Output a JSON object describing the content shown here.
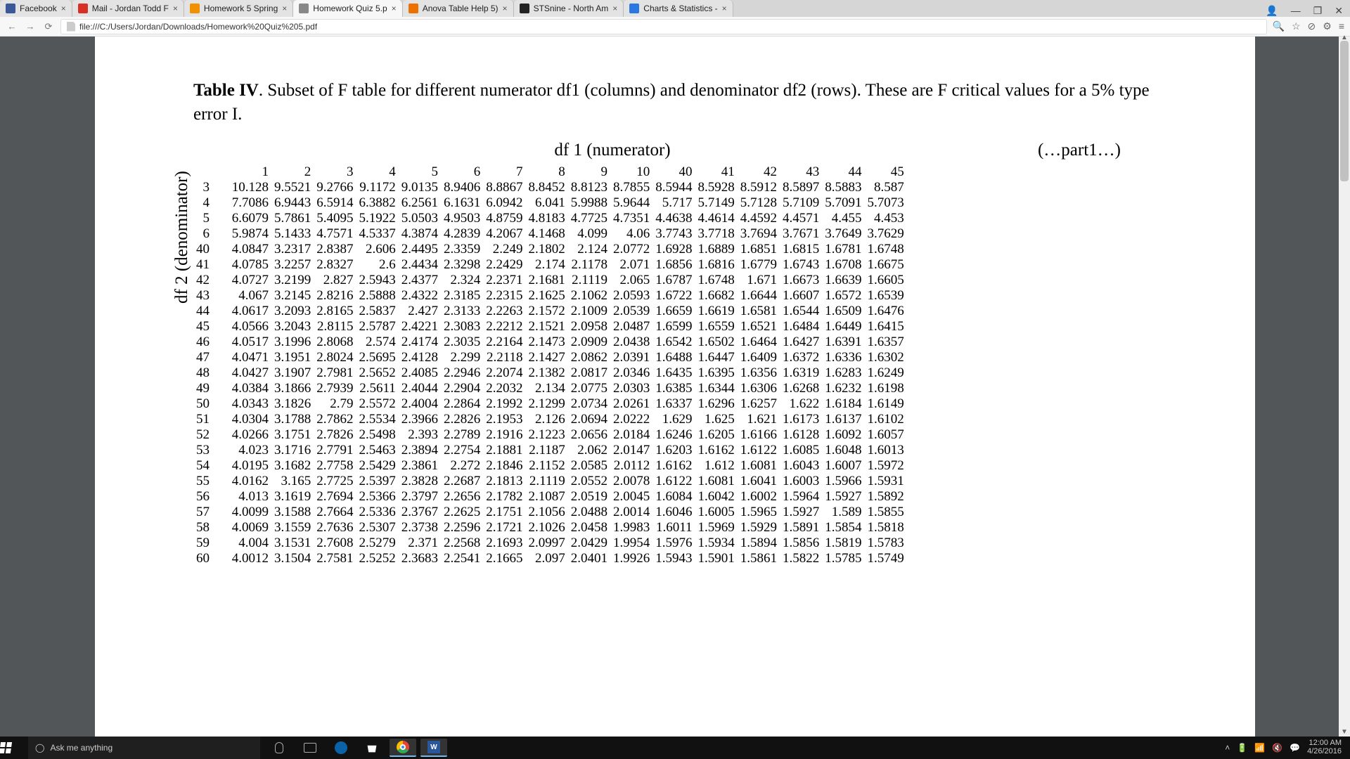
{
  "tabs": [
    {
      "title": "Facebook",
      "fav": "fav-fb"
    },
    {
      "title": "Mail - Jordan Todd F",
      "fav": "fav-gm"
    },
    {
      "title": "Homework 5 Spring",
      "fav": "fav-canvas"
    },
    {
      "title": "Homework Quiz 5.p",
      "fav": "fav-doc",
      "active": true
    },
    {
      "title": "Anova Table Help 5)",
      "fav": "fav-chegg"
    },
    {
      "title": "STSnine - North Am",
      "fav": "fav-st"
    },
    {
      "title": "Charts & Statistics -",
      "fav": "fav-chart"
    }
  ],
  "url": "file:///C:/Users/Jordan/Downloads/Homework%20Quiz%205.pdf",
  "doc": {
    "caption_strong": "Table IV",
    "caption_rest": ". Subset of F table for different numerator df1 (columns) and denominator df2 (rows). These are F critical values for a 5% type error I.",
    "header_center": "df 1 (numerator)",
    "header_right": "(…part1…)",
    "ylabel": "df 2 (denominator)"
  },
  "chart_data": {
    "type": "table",
    "title": "F critical values, α = 0.05",
    "col_label": "df1 (numerator)",
    "row_label": "df2 (denominator)",
    "columns": [
      1,
      2,
      3,
      4,
      5,
      6,
      7,
      8,
      9,
      10,
      40,
      41,
      42,
      43,
      44,
      45
    ],
    "rows": [
      3,
      4,
      5,
      6,
      40,
      41,
      42,
      43,
      44,
      45,
      46,
      47,
      48,
      49,
      50,
      51,
      52,
      53,
      54,
      55,
      56,
      57,
      58,
      59,
      60
    ],
    "values": [
      [
        10.128,
        9.5521,
        9.2766,
        9.1172,
        9.0135,
        8.9406,
        8.8867,
        8.8452,
        8.8123,
        8.7855,
        8.5944,
        8.5928,
        8.5912,
        8.5897,
        8.5883,
        8.587
      ],
      [
        7.7086,
        6.9443,
        6.5914,
        6.3882,
        6.2561,
        6.1631,
        6.0942,
        6.041,
        5.9988,
        5.9644,
        5.717,
        5.7149,
        5.7128,
        5.7109,
        5.7091,
        5.7073
      ],
      [
        6.6079,
        5.7861,
        5.4095,
        5.1922,
        5.0503,
        4.9503,
        4.8759,
        4.8183,
        4.7725,
        4.7351,
        4.4638,
        4.4614,
        4.4592,
        4.4571,
        4.455,
        4.453
      ],
      [
        5.9874,
        5.1433,
        4.7571,
        4.5337,
        4.3874,
        4.2839,
        4.2067,
        4.1468,
        4.099,
        4.06,
        3.7743,
        3.7718,
        3.7694,
        3.7671,
        3.7649,
        3.7629
      ],
      [
        4.0847,
        3.2317,
        2.8387,
        2.606,
        2.4495,
        2.3359,
        2.249,
        2.1802,
        2.124,
        2.0772,
        1.6928,
        1.6889,
        1.6851,
        1.6815,
        1.6781,
        1.6748
      ],
      [
        4.0785,
        3.2257,
        2.8327,
        2.6,
        2.4434,
        2.3298,
        2.2429,
        2.174,
        2.1178,
        2.071,
        1.6856,
        1.6816,
        1.6779,
        1.6743,
        1.6708,
        1.6675
      ],
      [
        4.0727,
        3.2199,
        2.827,
        2.5943,
        2.4377,
        2.324,
        2.2371,
        2.1681,
        2.1119,
        2.065,
        1.6787,
        1.6748,
        1.671,
        1.6673,
        1.6639,
        1.6605
      ],
      [
        4.067,
        3.2145,
        2.8216,
        2.5888,
        2.4322,
        2.3185,
        2.2315,
        2.1625,
        2.1062,
        2.0593,
        1.6722,
        1.6682,
        1.6644,
        1.6607,
        1.6572,
        1.6539
      ],
      [
        4.0617,
        3.2093,
        2.8165,
        2.5837,
        2.427,
        2.3133,
        2.2263,
        2.1572,
        2.1009,
        2.0539,
        1.6659,
        1.6619,
        1.6581,
        1.6544,
        1.6509,
        1.6476
      ],
      [
        4.0566,
        3.2043,
        2.8115,
        2.5787,
        2.4221,
        2.3083,
        2.2212,
        2.1521,
        2.0958,
        2.0487,
        1.6599,
        1.6559,
        1.6521,
        1.6484,
        1.6449,
        1.6415
      ],
      [
        4.0517,
        3.1996,
        2.8068,
        2.574,
        2.4174,
        2.3035,
        2.2164,
        2.1473,
        2.0909,
        2.0438,
        1.6542,
        1.6502,
        1.6464,
        1.6427,
        1.6391,
        1.6357
      ],
      [
        4.0471,
        3.1951,
        2.8024,
        2.5695,
        2.4128,
        2.299,
        2.2118,
        2.1427,
        2.0862,
        2.0391,
        1.6488,
        1.6447,
        1.6409,
        1.6372,
        1.6336,
        1.6302
      ],
      [
        4.0427,
        3.1907,
        2.7981,
        2.5652,
        2.4085,
        2.2946,
        2.2074,
        2.1382,
        2.0817,
        2.0346,
        1.6435,
        1.6395,
        1.6356,
        1.6319,
        1.6283,
        1.6249
      ],
      [
        4.0384,
        3.1866,
        2.7939,
        2.5611,
        2.4044,
        2.2904,
        2.2032,
        2.134,
        2.0775,
        2.0303,
        1.6385,
        1.6344,
        1.6306,
        1.6268,
        1.6232,
        1.6198
      ],
      [
        4.0343,
        3.1826,
        2.79,
        2.5572,
        2.4004,
        2.2864,
        2.1992,
        2.1299,
        2.0734,
        2.0261,
        1.6337,
        1.6296,
        1.6257,
        1.622,
        1.6184,
        1.6149
      ],
      [
        4.0304,
        3.1788,
        2.7862,
        2.5534,
        2.3966,
        2.2826,
        2.1953,
        2.126,
        2.0694,
        2.0222,
        1.629,
        1.625,
        1.621,
        1.6173,
        1.6137,
        1.6102
      ],
      [
        4.0266,
        3.1751,
        2.7826,
        2.5498,
        2.393,
        2.2789,
        2.1916,
        2.1223,
        2.0656,
        2.0184,
        1.6246,
        1.6205,
        1.6166,
        1.6128,
        1.6092,
        1.6057
      ],
      [
        4.023,
        3.1716,
        2.7791,
        2.5463,
        2.3894,
        2.2754,
        2.1881,
        2.1187,
        2.062,
        2.0147,
        1.6203,
        1.6162,
        1.6122,
        1.6085,
        1.6048,
        1.6013
      ],
      [
        4.0195,
        3.1682,
        2.7758,
        2.5429,
        2.3861,
        2.272,
        2.1846,
        2.1152,
        2.0585,
        2.0112,
        1.6162,
        1.612,
        1.6081,
        1.6043,
        1.6007,
        1.5972
      ],
      [
        4.0162,
        3.165,
        2.7725,
        2.5397,
        2.3828,
        2.2687,
        2.1813,
        2.1119,
        2.0552,
        2.0078,
        1.6122,
        1.6081,
        1.6041,
        1.6003,
        1.5966,
        1.5931
      ],
      [
        4.013,
        3.1619,
        2.7694,
        2.5366,
        2.3797,
        2.2656,
        2.1782,
        2.1087,
        2.0519,
        2.0045,
        1.6084,
        1.6042,
        1.6002,
        1.5964,
        1.5927,
        1.5892
      ],
      [
        4.0099,
        3.1588,
        2.7664,
        2.5336,
        2.3767,
        2.2625,
        2.1751,
        2.1056,
        2.0488,
        2.0014,
        1.6046,
        1.6005,
        1.5965,
        1.5927,
        1.589,
        1.5855
      ],
      [
        4.0069,
        3.1559,
        2.7636,
        2.5307,
        2.3738,
        2.2596,
        2.1721,
        2.1026,
        2.0458,
        1.9983,
        1.6011,
        1.5969,
        1.5929,
        1.5891,
        1.5854,
        1.5818
      ],
      [
        4.004,
        3.1531,
        2.7608,
        2.5279,
        2.371,
        2.2568,
        2.1693,
        2.0997,
        2.0429,
        1.9954,
        1.5976,
        1.5934,
        1.5894,
        1.5856,
        1.5819,
        1.5783
      ],
      [
        4.0012,
        3.1504,
        2.7581,
        2.5252,
        2.3683,
        2.2541,
        2.1665,
        2.097,
        2.0401,
        1.9926,
        1.5943,
        1.5901,
        1.5861,
        1.5822,
        1.5785,
        1.5749
      ]
    ]
  },
  "taskbar": {
    "search_placeholder": "Ask me anything",
    "time": "12:00 AM",
    "date": "4/26/2016"
  }
}
